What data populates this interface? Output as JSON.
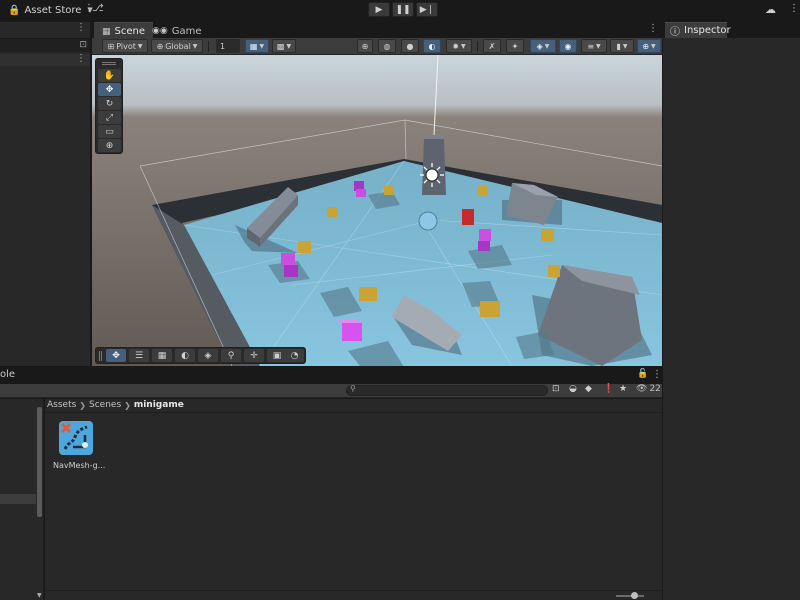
{
  "topbar": {
    "asset_store_label": "Asset Store",
    "icons": {
      "lock": "lock-icon",
      "caret": "chevron-down-icon",
      "menu": "more-vertical-icon",
      "version": "version-control-icon",
      "cloud": "cloud-icon"
    },
    "play_controls": [
      {
        "name": "play-button",
        "glyph": "▶"
      },
      {
        "name": "pause-button",
        "glyph": "❚❚"
      },
      {
        "name": "step-button",
        "glyph": "▶❘"
      }
    ]
  },
  "scene_panel": {
    "tabs": [
      {
        "label": "Scene",
        "active": true,
        "icon": "scene-icon"
      },
      {
        "label": "Game",
        "active": false,
        "icon": "game-controller-icon"
      }
    ],
    "toolbar": {
      "pivot_label": "Pivot",
      "global_label": "Global",
      "grid_size_value": "1"
    },
    "tools": [
      {
        "name": "hand-tool",
        "glyph": "✋",
        "active": false
      },
      {
        "name": "move-tool",
        "glyph": "✥",
        "active": true
      },
      {
        "name": "rotate-tool",
        "glyph": "↻",
        "active": false
      },
      {
        "name": "scale-tool",
        "glyph": "⤢",
        "active": false
      },
      {
        "name": "rect-tool",
        "glyph": "▭",
        "active": false
      },
      {
        "name": "transform-tool",
        "glyph": "⊕",
        "active": false
      }
    ],
    "overlay_tools": [
      {
        "name": "move-overlay-tool",
        "glyph": "✥",
        "active": true
      },
      {
        "name": "navmesh-settings-tool",
        "glyph": "☰",
        "active": false
      },
      {
        "name": "navmesh-grid-tool",
        "glyph": "▦",
        "active": false
      },
      {
        "name": "arc-tool",
        "glyph": "◐",
        "active": false
      },
      {
        "name": "navmesh-bake-tool",
        "glyph": "◈",
        "active": false
      },
      {
        "name": "search-tool",
        "glyph": "⚲",
        "active": false
      },
      {
        "name": "pan-tool",
        "glyph": "✛",
        "active": false
      },
      {
        "name": "camera-tool",
        "glyph": "▣",
        "active": false
      },
      {
        "name": "compass-tool",
        "glyph": "◔",
        "active": false
      }
    ]
  },
  "inspector": {
    "tab_label": "Inspector",
    "icon": "info-icon"
  },
  "project": {
    "partial_tab_text": "ole",
    "breadcrumb": [
      "Assets",
      "Scenes",
      "minigame"
    ],
    "hidden_packages_count": "22",
    "assets": [
      {
        "label": "NavMesh-g...",
        "icon": "navmesh-asset-icon"
      }
    ]
  },
  "colors": {
    "accent": "#46607c",
    "panel": "#282828",
    "toolbar": "#3c3c3c",
    "floor": "#7fb8d3"
  }
}
